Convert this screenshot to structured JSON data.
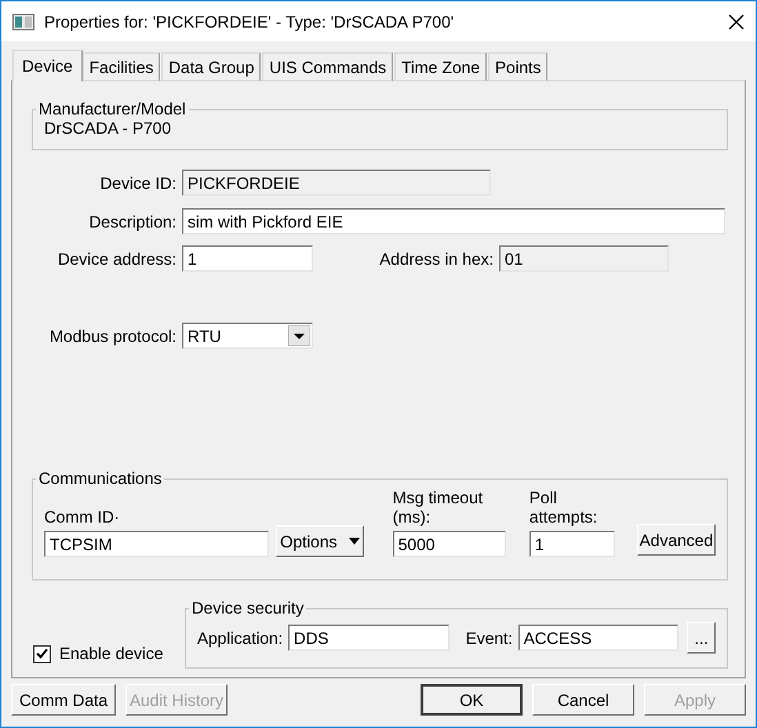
{
  "window": {
    "title": "Properties for: 'PICKFORDEIE' - Type: 'DrSCADA P700'"
  },
  "tabs": [
    {
      "label": "Device",
      "selected": true
    },
    {
      "label": "Facilities",
      "selected": false
    },
    {
      "label": "Data Group",
      "selected": false
    },
    {
      "label": "UIS Commands",
      "selected": false
    },
    {
      "label": "Time Zone",
      "selected": false
    },
    {
      "label": "Points",
      "selected": false
    }
  ],
  "manufacturer": {
    "legend": "Manufacturer/Model",
    "value": "DrSCADA - P700"
  },
  "device_id": {
    "label": "Device ID:",
    "value": "PICKFORDEIE",
    "read_only": true
  },
  "description": {
    "label": "Description:",
    "value": "sim with Pickford EIE",
    "read_only": false
  },
  "device_address": {
    "label": "Device address:",
    "value": "1",
    "read_only": false
  },
  "address_hex": {
    "label": "Address in hex:",
    "value": "01",
    "read_only": true
  },
  "modbus_protocol": {
    "label": "Modbus protocol:",
    "value": "RTU"
  },
  "communications": {
    "legend": "Communications",
    "comm_id": {
      "label": "Comm ID·",
      "value": "TCPSIM"
    },
    "options_button": "Options",
    "msg_timeout": {
      "label": "Msg timeout (ms):",
      "value": "5000"
    },
    "poll_attempts": {
      "label": "Poll attempts:",
      "value": "1"
    },
    "advanced_button": "Advanced"
  },
  "enable_device": {
    "label": "Enable device",
    "checked": true
  },
  "device_security": {
    "legend": "Device security",
    "application": {
      "label": "Application:",
      "value": "DDS"
    },
    "event": {
      "label": "Event:",
      "value": "ACCESS"
    },
    "browse_button": "..."
  },
  "buttons": [
    {
      "label": "Comm Data",
      "disabled": false,
      "default": false
    },
    {
      "label": "Audit History",
      "disabled": true,
      "default": false
    },
    {
      "label": "OK",
      "disabled": false,
      "default": true
    },
    {
      "label": "Cancel",
      "disabled": false,
      "default": false
    },
    {
      "label": "Apply",
      "disabled": true,
      "default": false
    }
  ]
}
